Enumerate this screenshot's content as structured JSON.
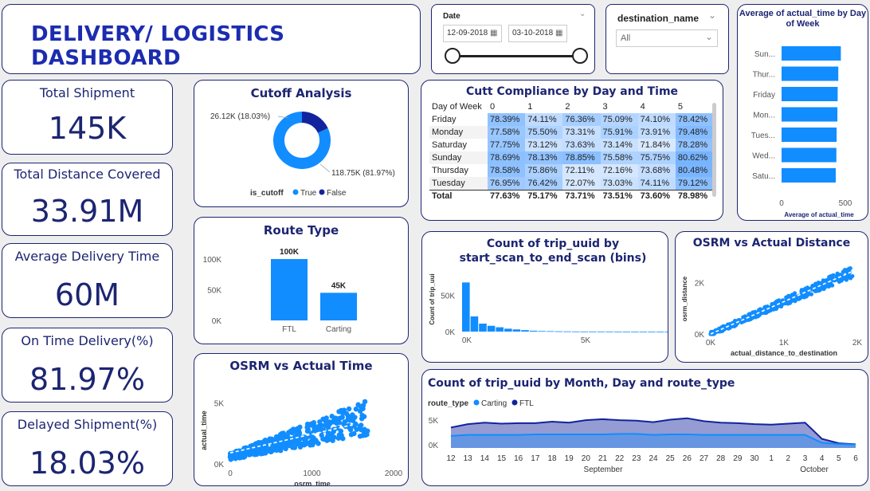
{
  "header": {
    "title": "DELIVERY/ LOGISTICS DASHBOARD"
  },
  "date_filter": {
    "label": "Date",
    "start": "12-09-2018",
    "end": "03-10-2018"
  },
  "destination_filter": {
    "label": "destination_name",
    "value": "All"
  },
  "kpis": [
    {
      "label": "Total Shipment",
      "value": "145K"
    },
    {
      "label": "Total Distance Covered",
      "value": "33.91M"
    },
    {
      "label": "Average Delivery Time",
      "value": "60M"
    },
    {
      "label": "On Time Delivery(%)",
      "value": "81.97%"
    },
    {
      "label": "Delayed Shipment(%)",
      "value": "18.03%"
    }
  ],
  "colors": {
    "primary": "#118dff",
    "dark": "#12239e",
    "title": "#1c2571"
  },
  "chart_data": [
    {
      "id": "cutoff",
      "type": "pie",
      "title": "Cutoff Analysis",
      "legend_title": "is_cutoff",
      "slices": [
        {
          "name": "True",
          "value": 118.75,
          "label": "118.75K (81.97%)",
          "color": "#118dff"
        },
        {
          "name": "False",
          "value": 26.12,
          "label": "26.12K (18.03%)",
          "color": "#12239e"
        }
      ]
    },
    {
      "id": "route_type",
      "type": "bar",
      "title": "Route Type",
      "categories": [
        "FTL",
        "Carting"
      ],
      "values": [
        100,
        45
      ],
      "data_labels": [
        "100K",
        "45K"
      ],
      "yticks": [
        "0K",
        "50K",
        "100K"
      ],
      "ylim": [
        0,
        100
      ]
    },
    {
      "id": "osrm_time",
      "type": "scatter",
      "title": "OSRM vs Actual Time",
      "xlabel": "osrm_time",
      "ylabel": "actual_time",
      "xticks": [
        "0",
        "1000",
        "2000"
      ],
      "yticks": [
        "0K",
        "5K"
      ],
      "xlim": [
        0,
        2000
      ],
      "ylim": [
        0,
        6000
      ],
      "trend": [
        [
          0,
          900
        ],
        [
          1500,
          3200
        ]
      ]
    },
    {
      "id": "compliance",
      "type": "table",
      "title": "Cutt Compliance by Day and Time",
      "columns": [
        "Day of Week",
        "0",
        "1",
        "2",
        "3",
        "4",
        "5"
      ],
      "rows": [
        [
          "Friday",
          "78.39%",
          "74.11%",
          "76.36%",
          "75.09%",
          "74.10%",
          "78.42%"
        ],
        [
          "Monday",
          "77.58%",
          "75.50%",
          "73.31%",
          "75.91%",
          "73.91%",
          "79.48%"
        ],
        [
          "Saturday",
          "77.75%",
          "73.12%",
          "73.63%",
          "73.14%",
          "71.84%",
          "78.28%"
        ],
        [
          "Sunday",
          "78.69%",
          "78.13%",
          "78.85%",
          "75.58%",
          "75.75%",
          "80.62%"
        ],
        [
          "Thursday",
          "78.58%",
          "75.86%",
          "72.11%",
          "72.16%",
          "73.68%",
          "80.48%"
        ],
        [
          "Tuesday",
          "76.95%",
          "76.42%",
          "72.07%",
          "73.03%",
          "74.11%",
          "79.12%"
        ]
      ],
      "total": [
        "Total",
        "77.63%",
        "75.17%",
        "73.71%",
        "73.51%",
        "73.60%",
        "78.98%"
      ]
    },
    {
      "id": "avg_actual_time",
      "type": "bar",
      "orientation": "horizontal",
      "title": "Average of actual_time by Day of Week",
      "categories": [
        "Sun...",
        "Thur...",
        "Friday",
        "Mon...",
        "Tues...",
        "Wed...",
        "Satu..."
      ],
      "values": [
        465,
        445,
        440,
        438,
        432,
        430,
        425
      ],
      "xticks": [
        "0",
        "500"
      ],
      "xlim": [
        0,
        500
      ],
      "xlabel": "Average of actual_time"
    },
    {
      "id": "trip_bins",
      "type": "bar",
      "title": "Count of trip_uuid by start_scan_to_end_scan (bins)",
      "ylabel": "Count of trip_uuid",
      "xticks": [
        "0K",
        "5K"
      ],
      "yticks": [
        "0K",
        "50K"
      ],
      "ylim": [
        0,
        75000
      ],
      "values": [
        68000,
        21000,
        11000,
        8000,
        6000,
        4000,
        3000,
        2000,
        1200,
        800,
        600,
        400,
        300,
        200,
        150,
        120,
        100,
        80,
        60,
        40,
        30,
        20,
        10,
        10,
        5,
        5,
        400,
        100
      ]
    },
    {
      "id": "osrm_distance",
      "type": "scatter",
      "title": "OSRM vs Actual Distance",
      "xlabel": "actual_distance_to_destination",
      "ylabel": "osrm_distance",
      "xticks": [
        "0K",
        "1K",
        "2K"
      ],
      "yticks": [
        "0K",
        "2K"
      ],
      "xlim": [
        0,
        2000
      ],
      "ylim": [
        0,
        2600
      ],
      "trend": [
        [
          0,
          0
        ],
        [
          1950,
          2450
        ]
      ]
    },
    {
      "id": "monthly",
      "type": "area",
      "title": "Count of trip_uuid by Month, Day and route_type",
      "legend_title": "route_type",
      "x": [
        "12",
        "13",
        "14",
        "15",
        "16",
        "17",
        "18",
        "19",
        "20",
        "21",
        "22",
        "23",
        "24",
        "25",
        "26",
        "27",
        "28",
        "29",
        "30",
        "1",
        "2",
        "3",
        "4",
        "5",
        "6"
      ],
      "months": [
        "September",
        "October"
      ],
      "yticks": [
        "0K",
        "5K"
      ],
      "ylim": [
        0,
        6000
      ],
      "series": [
        {
          "name": "Carting",
          "values": [
            1800,
            2000,
            2000,
            2000,
            2000,
            2100,
            2100,
            2100,
            2100,
            2100,
            2200,
            2200,
            2000,
            2100,
            2100,
            2000,
            2000,
            2000,
            2000,
            2000,
            2000,
            2000,
            400,
            150,
            50
          ]
        },
        {
          "name": "FTL",
          "values": [
            3500,
            4200,
            4500,
            4300,
            4400,
            4400,
            4700,
            4500,
            5000,
            5200,
            5000,
            4900,
            4600,
            5100,
            5400,
            4800,
            4500,
            4400,
            4200,
            4100,
            4300,
            4500,
            1200,
            300,
            100
          ]
        }
      ]
    }
  ]
}
